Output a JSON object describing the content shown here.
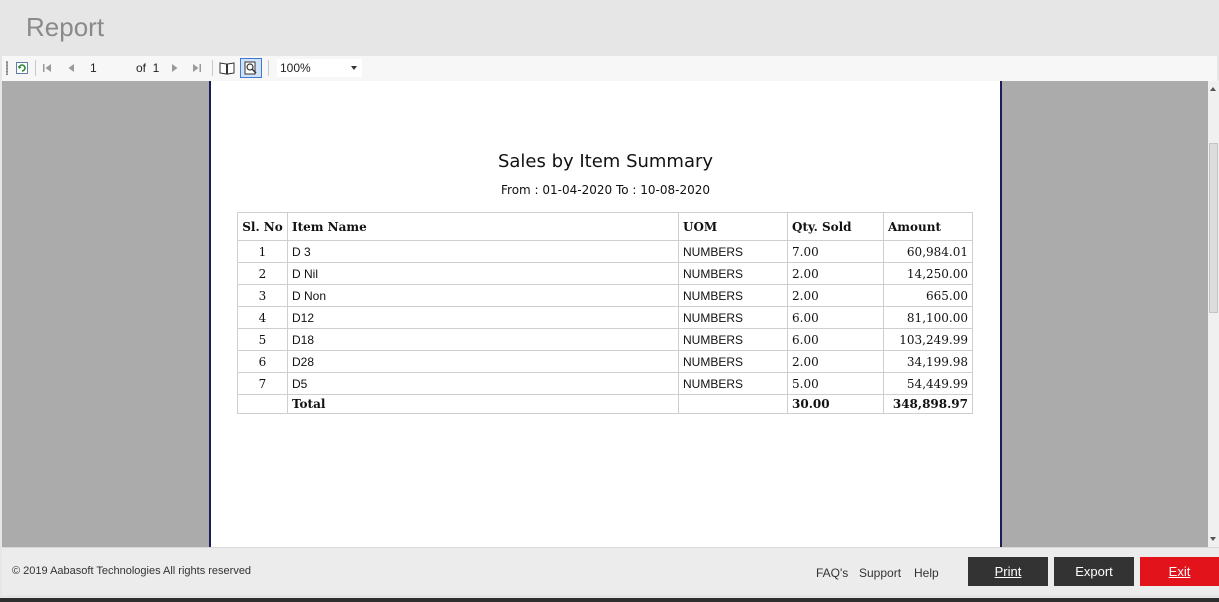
{
  "window": {
    "title": "Report"
  },
  "toolbar": {
    "current_page": "1",
    "of_label": "of",
    "total_pages": "1",
    "zoom": "100%"
  },
  "report": {
    "title": "Sales by Item Summary",
    "date_range": "From : 01-04-2020 To : 10-08-2020",
    "columns": {
      "sl": "Sl. No",
      "item": "Item Name",
      "uom": "UOM",
      "qty": "Qty. Sold",
      "amount": "Amount"
    },
    "rows": [
      {
        "sl": "1",
        "item": "D 3",
        "uom": "NUMBERS",
        "qty": "7.00",
        "amount": "60,984.01"
      },
      {
        "sl": "2",
        "item": "D Nil",
        "uom": "NUMBERS",
        "qty": "2.00",
        "amount": "14,250.00"
      },
      {
        "sl": "3",
        "item": "D Non",
        "uom": "NUMBERS",
        "qty": "2.00",
        "amount": "665.00"
      },
      {
        "sl": "4",
        "item": "D12",
        "uom": "NUMBERS",
        "qty": "6.00",
        "amount": "81,100.00"
      },
      {
        "sl": "5",
        "item": "D18",
        "uom": "NUMBERS",
        "qty": "6.00",
        "amount": "103,249.99"
      },
      {
        "sl": "6",
        "item": "D28",
        "uom": "NUMBERS",
        "qty": "2.00",
        "amount": "34,199.98"
      },
      {
        "sl": "7",
        "item": "D5",
        "uom": "NUMBERS",
        "qty": "5.00",
        "amount": "54,449.99"
      }
    ],
    "total": {
      "label": "Total",
      "qty": "30.00",
      "amount": "348,898.97"
    }
  },
  "footer": {
    "copyright": "© 2019 Aabasoft Technologies All rights reserved",
    "links": {
      "faq": "FAQ's",
      "support": "Support",
      "help": "Help"
    },
    "buttons": {
      "print": "Print",
      "export": "Export",
      "exit": "Exit"
    }
  },
  "colors": {
    "exit_button": "#e2131a",
    "dark_button": "#333333",
    "viewer_background": "#ababab",
    "page_border": "#1c1c5a"
  },
  "icons": {
    "refresh": "refresh-icon",
    "first_page": "first-page-icon",
    "prev_page": "previous-page-icon",
    "next_page": "next-page-icon",
    "last_page": "last-page-icon",
    "print_layout": "print-layout-icon",
    "page_setup": "page-setup-icon"
  }
}
